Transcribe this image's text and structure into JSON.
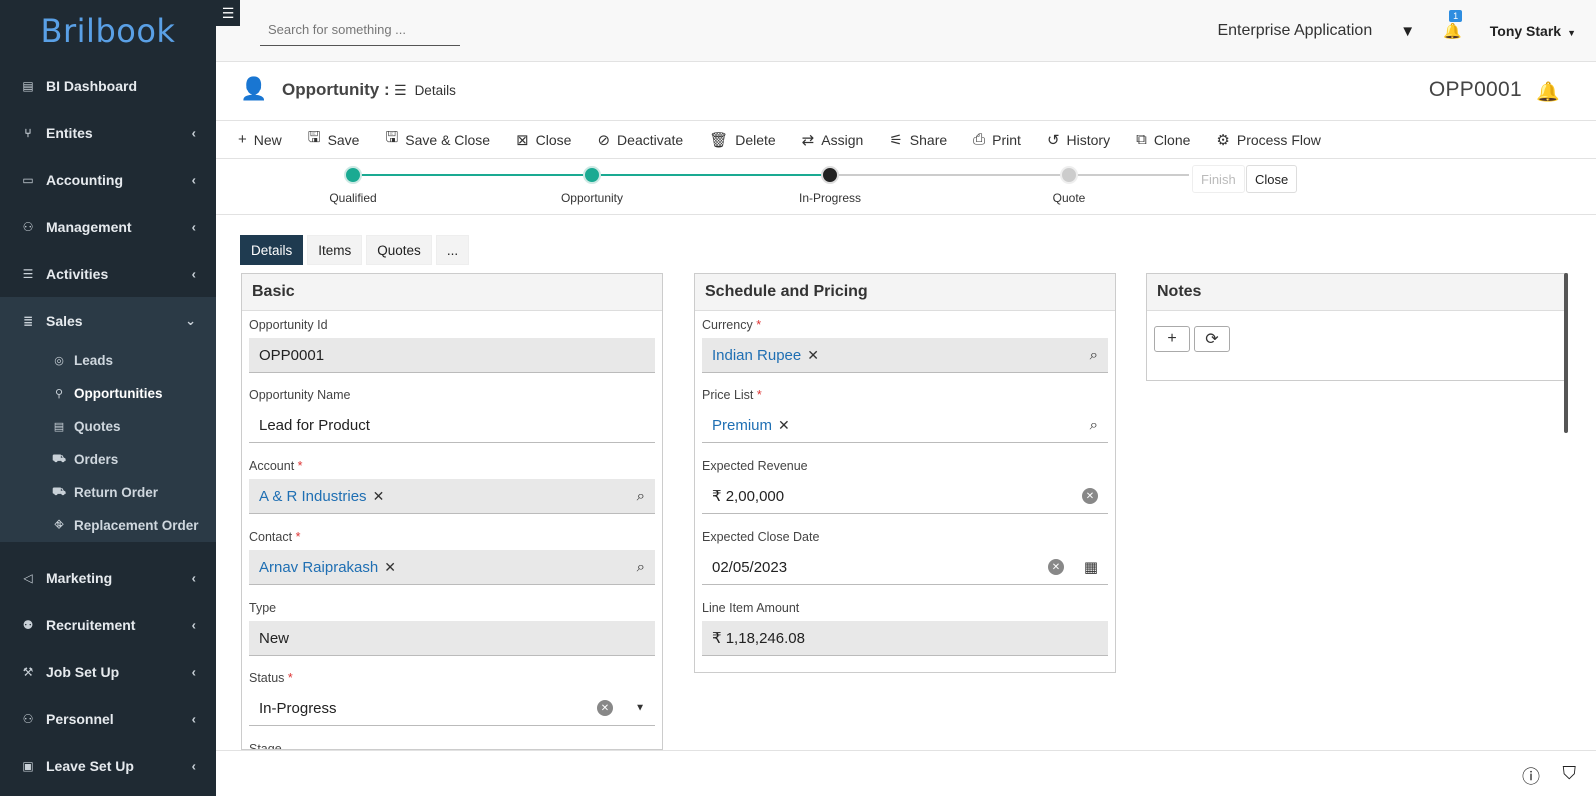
{
  "brand": {
    "logo_text": "Brilbook"
  },
  "sidebar": {
    "items": [
      {
        "label": "BI Dashboard",
        "icon": "chart-icon",
        "glyph": "▤"
      },
      {
        "label": "Entites",
        "icon": "branch-icon",
        "glyph": "⑂"
      },
      {
        "label": "Accounting",
        "icon": "wallet-icon",
        "glyph": "▭"
      },
      {
        "label": "Management",
        "icon": "users-cog-icon",
        "glyph": "⚇"
      },
      {
        "label": "Activities",
        "icon": "list-icon",
        "glyph": "☰"
      },
      {
        "label": "Sales",
        "icon": "sales-icon",
        "glyph": "≣"
      },
      {
        "label": "Marketing",
        "icon": "bullhorn-icon",
        "glyph": "◁"
      },
      {
        "label": "Recruitement",
        "icon": "user-badge-icon",
        "glyph": "⚉"
      },
      {
        "label": "Job Set Up",
        "icon": "person-work-icon",
        "glyph": "⚒"
      },
      {
        "label": "Personnel",
        "icon": "personnel-icon",
        "glyph": "⚇"
      },
      {
        "label": "Leave Set Up",
        "icon": "leave-icon",
        "glyph": "▣"
      }
    ],
    "sales_sub": [
      {
        "label": "Leads",
        "icon": "leads-icon",
        "glyph": "◎"
      },
      {
        "label": "Opportunities",
        "icon": "user-plus-icon",
        "glyph": "⚲"
      },
      {
        "label": "Quotes",
        "icon": "quote-icon",
        "glyph": "▤"
      },
      {
        "label": "Orders",
        "icon": "orders-icon",
        "glyph": "⛟"
      },
      {
        "label": "Return Order",
        "icon": "return-icon",
        "glyph": "⛟"
      },
      {
        "label": "Replacement Order",
        "icon": "replace-icon",
        "glyph": "⛗"
      }
    ]
  },
  "topbar": {
    "search_placeholder": "Search for something ...",
    "app_name": "Enterprise Application",
    "notification_count": "1",
    "user_name": "Tony Stark"
  },
  "page_header": {
    "title": "Opportunity :",
    "view": "Details",
    "record_id": "OPP0001"
  },
  "toolbar": [
    {
      "label": "New",
      "icon": "plus-icon",
      "glyph": "+"
    },
    {
      "label": "Save",
      "icon": "save-icon",
      "glyph": "🖫"
    },
    {
      "label": "Save & Close",
      "icon": "save-close-icon",
      "glyph": "🖫"
    },
    {
      "label": "Close",
      "icon": "close-box-icon",
      "glyph": "⊠"
    },
    {
      "label": "Deactivate",
      "icon": "ban-icon",
      "glyph": "⊘"
    },
    {
      "label": "Delete",
      "icon": "trash-icon",
      "glyph": "🗑"
    },
    {
      "label": "Assign",
      "icon": "swap-icon",
      "glyph": "⇄"
    },
    {
      "label": "Share",
      "icon": "share-icon",
      "glyph": "⚟"
    },
    {
      "label": "Print",
      "icon": "print-icon",
      "glyph": "⎙"
    },
    {
      "label": "History",
      "icon": "history-icon",
      "glyph": "↺"
    },
    {
      "label": "Clone",
      "icon": "clone-icon",
      "glyph": "⧉"
    },
    {
      "label": "Process Flow",
      "icon": "flow-icon",
      "glyph": "⚙"
    }
  ],
  "process_flow": {
    "stages": [
      {
        "label": "Qualified",
        "state": "done"
      },
      {
        "label": "Opportunity",
        "state": "done"
      },
      {
        "label": "In-Progress",
        "state": "current"
      },
      {
        "label": "Quote",
        "state": "pending"
      }
    ],
    "finish_label": "Finish",
    "close_label": "Close",
    "colors": {
      "done": "#1aaa92",
      "current": "#222222",
      "pending": "#cccccc"
    }
  },
  "tabs": [
    "Details",
    "Items",
    "Quotes",
    "..."
  ],
  "basic": {
    "title": "Basic",
    "fields": [
      {
        "label": "Opportunity Id",
        "value": "OPP0001",
        "required": false
      },
      {
        "label": "Opportunity Name",
        "value": "Lead for Product",
        "required": false
      },
      {
        "label": "Account",
        "value": "A & R Industries",
        "required": true
      },
      {
        "label": "Contact",
        "value": "Arnav Raiprakash",
        "required": true
      },
      {
        "label": "Type",
        "value": "New",
        "required": false
      },
      {
        "label": "Status",
        "value": "In-Progress",
        "required": true
      },
      {
        "label": "Stage",
        "value": "",
        "required": false
      }
    ]
  },
  "schedule": {
    "title": "Schedule and Pricing",
    "fields": [
      {
        "label": "Currency",
        "value": "Indian Rupee",
        "required": true
      },
      {
        "label": "Price List",
        "value": "Premium",
        "required": true
      },
      {
        "label": "Expected Revenue",
        "value": "₹ 2,00,000",
        "required": false
      },
      {
        "label": "Expected Close Date",
        "value": "02/05/2023",
        "required": false
      },
      {
        "label": "Line Item Amount",
        "value": "₹ 1,18,246.08",
        "required": false
      }
    ]
  },
  "notes": {
    "title": "Notes"
  },
  "required_marker": "*"
}
